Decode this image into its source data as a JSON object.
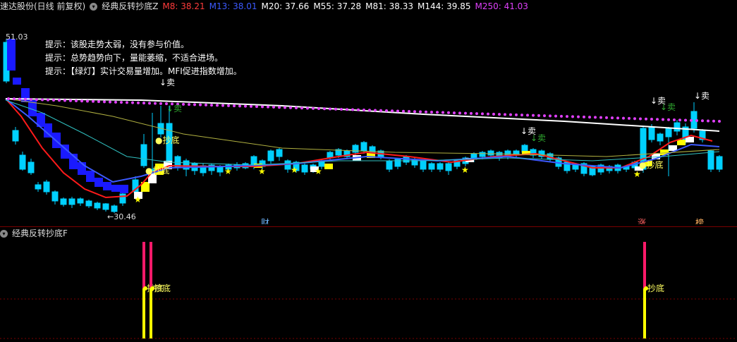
{
  "header": {
    "stock": "速达股份(日线 前复权)",
    "indicator": "经典反转抄底Z",
    "mas": [
      {
        "label": "M8: 38.21",
        "color": "#ff3b3b"
      },
      {
        "label": "M13: 38.01",
        "color": "#3c5aff"
      },
      {
        "label": "M20: 37.66",
        "color": "#ffffff"
      },
      {
        "label": "M55: 37.28",
        "color": "#ffffff"
      },
      {
        "label": "M81: 38.33",
        "color": "#ffffff"
      },
      {
        "label": "M144: 39.85",
        "color": "#ffffff"
      },
      {
        "label": "M250: 41.03",
        "color": "#e040fb"
      }
    ]
  },
  "tips": [
    "提示：该股走势太弱，没有参与价值。",
    "提示：总势趋势向下，量能萎缩，不适合进场。",
    "提示：【绿灯】实计交易量增加。MFI促进指数增加。"
  ],
  "sub_header": {
    "indicator": "经典反转抄底F"
  },
  "chart_data": {
    "type": "candlestick",
    "price_high_label": "51.03",
    "price_low_label": "←30.46",
    "sell_label": "↓卖",
    "buy_label": "抄底",
    "badges": [
      {
        "text": "财",
        "color": "#6fb7ff"
      },
      {
        "text": "涨",
        "color": "#ff6060"
      },
      {
        "text": "榜",
        "color": "#ffb060"
      }
    ],
    "sub_bars": [
      {
        "label": "抄底"
      },
      {
        "label": "抄底"
      },
      {
        "label": "抄底"
      }
    ]
  }
}
